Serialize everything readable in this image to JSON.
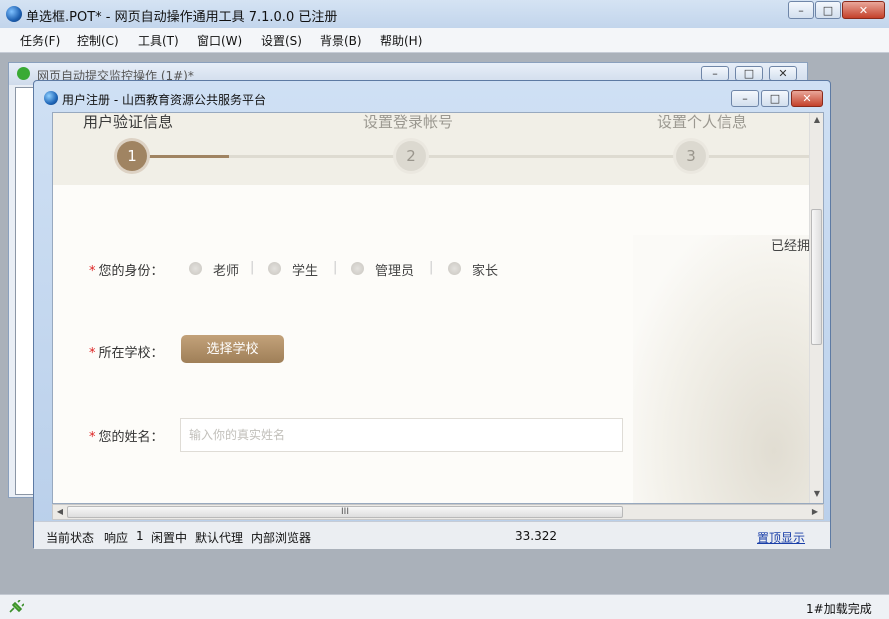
{
  "app": {
    "title": "单选框.POT* - 网页自动操作通用工具 7.1.0.0  已注册",
    "menu": [
      "任务(F)",
      "控制(C)",
      "工具(T)",
      "窗口(W)",
      "设置(S)",
      "背景(B)",
      "帮助(H)"
    ],
    "status_right": "1#加载完成"
  },
  "monitor_window": {
    "title": "网页自动提交监控操作  (1#)*"
  },
  "dialog": {
    "title": "用户注册 - 山西教育资源公共服务平台",
    "steps": [
      {
        "label": "用户验证信息",
        "number": "1",
        "active": true
      },
      {
        "label": "设置登录帐号",
        "number": "2",
        "active": false
      },
      {
        "label": "设置个人信息",
        "number": "3",
        "active": false
      }
    ],
    "already_text": "已经拥",
    "form": {
      "required_mark": "*",
      "identity_label": "您的身份：",
      "identity_options": [
        "老师",
        "学生",
        "管理员",
        "家长"
      ],
      "separator": "|",
      "school_label": "所在学校：",
      "school_button": "选择学校",
      "name_label": "您的姓名：",
      "name_placeholder": "输入你的真实姓名",
      "name_value": ""
    },
    "status": {
      "state": "当前状态",
      "response": "响应",
      "response_count": "1",
      "idle": "闲置中",
      "proxy": "默认代理",
      "browser": "内部浏览器",
      "value": "33.322",
      "pin": "置顶显示"
    },
    "scroll_glyph": "III"
  },
  "icons": {
    "app": "globe-icon",
    "monitor": "check-circle-icon",
    "dialog": "globe-icon",
    "status": "plug-icon"
  },
  "colors": {
    "accent": "#a08462",
    "required": "#dd2222",
    "link": "#1a3fa8"
  }
}
